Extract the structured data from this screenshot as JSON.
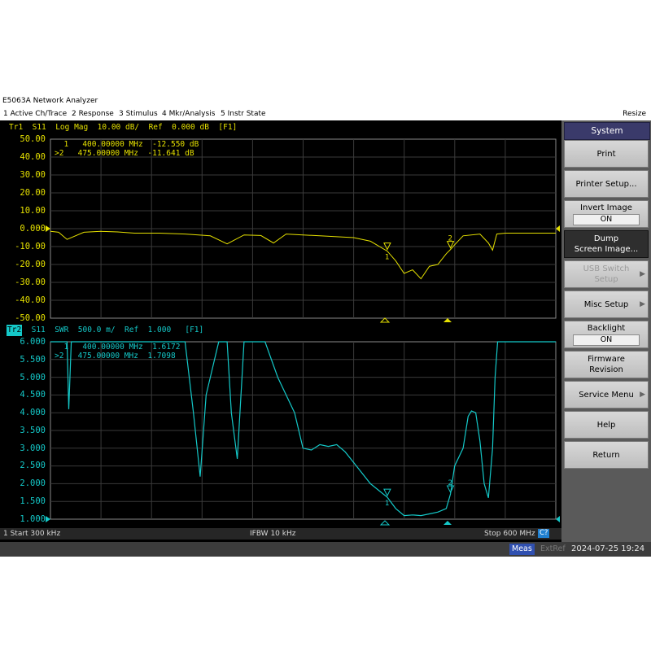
{
  "window": {
    "title": "E5063A Network Analyzer"
  },
  "menu": {
    "items": [
      "1 Active Ch/Trace",
      "2 Response",
      "3 Stimulus",
      "4 Mkr/Analysis",
      "5 Instr State"
    ],
    "resize": "Resize"
  },
  "trace1": {
    "header": "Tr1  S11  Log Mag  10.00 dB/  Ref  0.000 dB  [F1]",
    "markers": [
      "  1   400.00000 MHz  -12.550 dB",
      ">2   475.00000 MHz  -11.641 dB"
    ],
    "yticks": [
      "50.00",
      "40.00",
      "30.00",
      "20.00",
      "10.00",
      "0.000",
      "-10.00",
      "-20.00",
      "-30.00",
      "-40.00",
      "-50.00"
    ],
    "color": "#e5e000"
  },
  "trace2": {
    "badge": "Tr2",
    "header": "  S11  SWR  500.0 m/  Ref  1.000   [F1]",
    "markers": [
      "  1   400.00000 MHz  1.6172",
      ">2   475.00000 MHz  1.7098"
    ],
    "yticks": [
      "6.000",
      "5.500",
      "5.000",
      "4.500",
      "4.000",
      "3.500",
      "3.000",
      "2.500",
      "2.000",
      "1.500",
      "1.000"
    ],
    "color": "#14c8c8"
  },
  "chart_data": [
    {
      "type": "line",
      "series": [
        {
          "name": "Tr1 S11 Log Mag",
          "x": [
            0.3,
            10,
            20,
            40,
            60,
            80,
            100,
            130,
            160,
            190,
            210,
            230,
            250,
            265,
            280,
            300,
            320,
            340,
            360,
            380,
            400,
            410,
            420,
            430,
            440,
            450,
            460,
            470,
            475,
            480,
            490,
            510,
            520,
            525,
            530,
            540,
            560,
            580,
            600
          ],
          "y": [
            -1.5,
            -2.0,
            -6.0,
            -2.0,
            -1.5,
            -1.8,
            -2.5,
            -2.5,
            -3.0,
            -4.0,
            -8.5,
            -3.5,
            -3.8,
            -8.0,
            -3.0,
            -3.5,
            -4.0,
            -4.5,
            -5.0,
            -7.0,
            -12.55,
            -18.0,
            -25.0,
            -23.0,
            -28.0,
            -21.0,
            -20.0,
            -14.0,
            -11.64,
            -9.0,
            -4.0,
            -3.0,
            -8.0,
            -12.0,
            -3.0,
            -2.5,
            -2.5,
            -2.5,
            -2.5
          ]
        }
      ],
      "xlabel": "",
      "ylabel": "",
      "xlim": [
        0.3,
        600
      ],
      "ylim": [
        -50,
        50
      ]
    },
    {
      "type": "line",
      "series": [
        {
          "name": "Tr2 S11 SWR",
          "x": [
            0.3,
            5,
            15,
            20,
            22,
            25,
            30,
            60,
            120,
            160,
            170,
            178,
            185,
            200,
            210,
            215,
            222,
            230,
            245,
            255,
            270,
            290,
            300,
            310,
            320,
            330,
            340,
            350,
            360,
            380,
            400,
            410,
            420,
            430,
            440,
            450,
            460,
            470,
            475,
            480,
            490,
            496,
            500,
            505,
            510,
            515,
            520,
            525,
            528,
            531,
            535,
            600
          ],
          "y": [
            6.0,
            6.0,
            6.0,
            6.0,
            4.1,
            6.0,
            6.0,
            6.0,
            6.0,
            6.0,
            4.0,
            2.2,
            4.5,
            6.0,
            6.0,
            4.0,
            2.7,
            6.0,
            6.0,
            6.0,
            5.0,
            4.0,
            3.0,
            2.95,
            3.1,
            3.05,
            3.1,
            2.9,
            2.6,
            2.0,
            1.62,
            1.3,
            1.1,
            1.12,
            1.1,
            1.15,
            1.2,
            1.3,
            1.71,
            2.5,
            3.0,
            3.9,
            4.05,
            4.0,
            3.2,
            2.0,
            1.6,
            3.0,
            5.0,
            6.0,
            6.0,
            6.0
          ]
        }
      ],
      "xlabel": "",
      "ylabel": "",
      "xlim": [
        0.3,
        600
      ],
      "ylim": [
        1.0,
        6.0
      ]
    }
  ],
  "status": {
    "start": "1  Start 300 kHz",
    "ifbw": "IFBW 10 kHz",
    "stop": "Stop 600 MHz",
    "channel_badge": "C?"
  },
  "softkeys": {
    "title": "System",
    "keys": [
      {
        "label": "Print"
      },
      {
        "label": "Printer Setup..."
      },
      {
        "label": "Invert Image",
        "value": "ON"
      },
      {
        "label": "Dump",
        "label2": "Screen Image..."
      },
      {
        "label": "USB Switch",
        "label2": "Setup"
      },
      {
        "label": "Misc Setup"
      },
      {
        "label": "Backlight",
        "value": "ON"
      },
      {
        "label": "Firmware",
        "label2": "Revision"
      },
      {
        "label": "Service Menu"
      },
      {
        "label": "Help"
      },
      {
        "label": "Return"
      }
    ]
  },
  "bottom": {
    "meas": "Meas",
    "extref": "ExtRef",
    "datetime": "2024-07-25 19:24"
  }
}
